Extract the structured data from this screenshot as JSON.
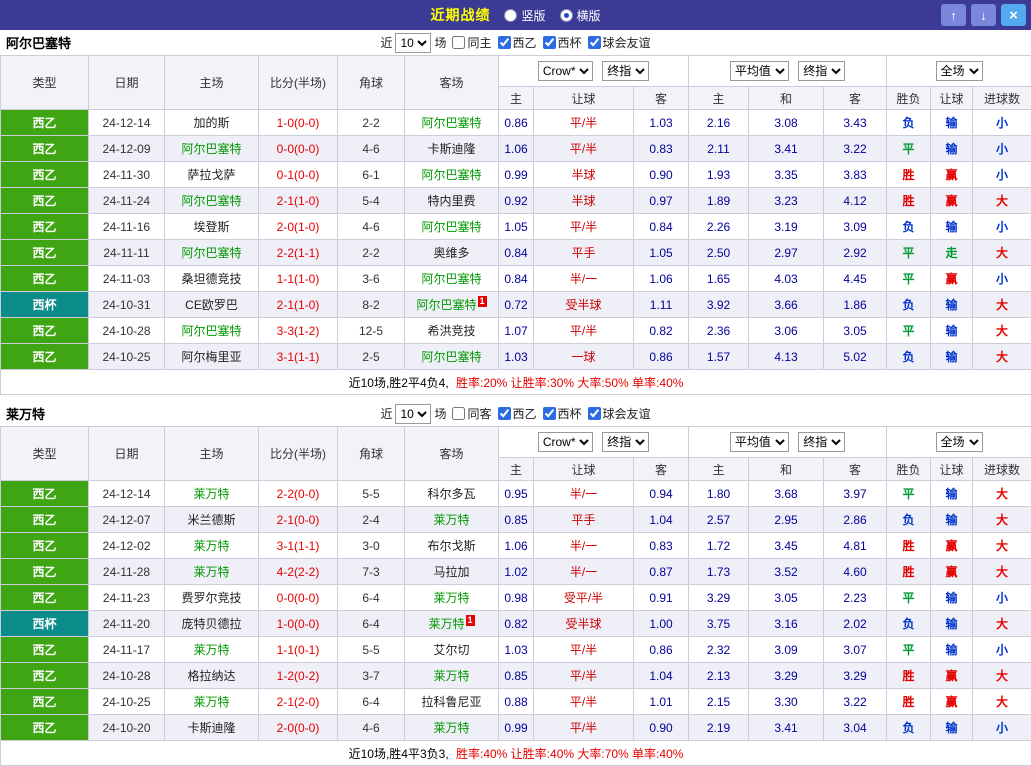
{
  "topbar": {
    "title": "近期战绩",
    "radios": [
      {
        "label": "竖版",
        "selected": false
      },
      {
        "label": "横版",
        "selected": true
      }
    ],
    "up_button": "↑",
    "down_button": "↓",
    "close_button": "×"
  },
  "palette": {
    "red": "#e60000",
    "green": "#009933",
    "blue": "#0033cc"
  },
  "value_colors": {
    "胜": "red",
    "平": "green",
    "负": "blue",
    "赢": "red",
    "走": "green",
    "输": "blue",
    "大": "red",
    "小": "blue"
  },
  "league_colors": {
    "西乙": "#3fa513",
    "西杯": "#0c8b8b"
  },
  "sections": [
    {
      "team": "阿尔巴塞特",
      "filter": {
        "near": "近",
        "count": "10",
        "unit": "场",
        "checkboxes": [
          {
            "label": "同主",
            "checked": false
          },
          {
            "label": "西乙",
            "checked": true
          },
          {
            "label": "西杯",
            "checked": true
          },
          {
            "label": "球会友谊",
            "checked": true
          }
        ]
      },
      "header": {
        "type": "类型",
        "date": "日期",
        "home": "主场",
        "score": "比分(半场)",
        "corner": "角球",
        "away": "客场",
        "odds_select_1": "Crow*",
        "odds_select_2": "终指",
        "avg_select_1": "平均值",
        "avg_select_2": "终指",
        "scope_select": "全场",
        "sub_home": "主",
        "sub_handicap": "让球",
        "sub_away": "客",
        "sub_avg_home": "主",
        "sub_draw": "和",
        "sub_avg_away": "客",
        "sub_result": "胜负",
        "sub_handicap2": "让球",
        "sub_goals": "进球数"
      },
      "rows": [
        {
          "league": "西乙",
          "date": "24-12-14",
          "home": "加的斯",
          "score": "1-0(0-0)",
          "corner": "2-2",
          "away": "阿尔巴塞特",
          "odds": [
            "0.86",
            "平/半",
            "1.03"
          ],
          "avg": [
            "2.16",
            "3.08",
            "3.43"
          ],
          "result": "负",
          "handicap": "输",
          "goals": "小"
        },
        {
          "league": "西乙",
          "date": "24-12-09",
          "home": "阿尔巴塞特",
          "score": "0-0(0-0)",
          "corner": "4-6",
          "away": "卡斯迪隆",
          "odds": [
            "1.06",
            "平/半",
            "0.83"
          ],
          "avg": [
            "2.11",
            "3.41",
            "3.22"
          ],
          "result": "平",
          "handicap": "输",
          "goals": "小"
        },
        {
          "league": "西乙",
          "date": "24-11-30",
          "home": "萨拉戈萨",
          "score": "0-1(0-0)",
          "corner": "6-1",
          "away": "阿尔巴塞特",
          "odds": [
            "0.99",
            "半球",
            "0.90"
          ],
          "avg": [
            "1.93",
            "3.35",
            "3.83"
          ],
          "result": "胜",
          "handicap": "赢",
          "goals": "小"
        },
        {
          "league": "西乙",
          "date": "24-11-24",
          "home": "阿尔巴塞特",
          "score": "2-1(1-0)",
          "corner": "5-4",
          "away": "特内里费",
          "odds": [
            "0.92",
            "半球",
            "0.97"
          ],
          "avg": [
            "1.89",
            "3.23",
            "4.12"
          ],
          "result": "胜",
          "handicap": "赢",
          "goals": "大"
        },
        {
          "league": "西乙",
          "date": "24-11-16",
          "home": "埃登斯",
          "score": "2-0(1-0)",
          "corner": "4-6",
          "away": "阿尔巴塞特",
          "odds": [
            "1.05",
            "平/半",
            "0.84"
          ],
          "avg": [
            "2.26",
            "3.19",
            "3.09"
          ],
          "result": "负",
          "handicap": "输",
          "goals": "小"
        },
        {
          "league": "西乙",
          "date": "24-11-11",
          "home": "阿尔巴塞特",
          "score": "2-2(1-1)",
          "corner": "2-2",
          "away": "奥维多",
          "odds": [
            "0.84",
            "平手",
            "1.05"
          ],
          "avg": [
            "2.50",
            "2.97",
            "2.92"
          ],
          "result": "平",
          "handicap": "走",
          "goals": "大"
        },
        {
          "league": "西乙",
          "date": "24-11-03",
          "home": "桑坦德竞技",
          "score": "1-1(1-0)",
          "corner": "3-6",
          "away": "阿尔巴塞特",
          "odds": [
            "0.84",
            "半/一",
            "1.06"
          ],
          "avg": [
            "1.65",
            "4.03",
            "4.45"
          ],
          "result": "平",
          "handicap": "赢",
          "goals": "小"
        },
        {
          "league": "西杯",
          "date": "24-10-31",
          "home": "CE欧罗巴",
          "score": "2-1(1-0)",
          "corner": "8-2",
          "away": "阿尔巴塞特",
          "away_badge": "1",
          "odds": [
            "0.72",
            "受半球",
            "1.11"
          ],
          "avg": [
            "3.92",
            "3.66",
            "1.86"
          ],
          "result": "负",
          "handicap": "输",
          "goals": "大"
        },
        {
          "league": "西乙",
          "date": "24-10-28",
          "home": "阿尔巴塞特",
          "score": "3-3(1-2)",
          "corner": "12-5",
          "away": "希洪竞技",
          "odds": [
            "1.07",
            "平/半",
            "0.82"
          ],
          "avg": [
            "2.36",
            "3.06",
            "3.05"
          ],
          "result": "平",
          "handicap": "输",
          "goals": "大"
        },
        {
          "league": "西乙",
          "date": "24-10-25",
          "home": "阿尔梅里亚",
          "score": "3-1(1-1)",
          "corner": "2-5",
          "away": "阿尔巴塞特",
          "odds": [
            "1.03",
            "一球",
            "0.86"
          ],
          "avg": [
            "1.57",
            "4.13",
            "5.02"
          ],
          "result": "负",
          "handicap": "输",
          "goals": "大"
        }
      ],
      "summary": {
        "prefix": "近10场,胜2平4负4,",
        "stats": "胜率:20% 让胜率:30% 大率:50% 单率:40%"
      }
    },
    {
      "team": "莱万特",
      "filter": {
        "near": "近",
        "count": "10",
        "unit": "场",
        "checkboxes": [
          {
            "label": "同客",
            "checked": false
          },
          {
            "label": "西乙",
            "checked": true
          },
          {
            "label": "西杯",
            "checked": true
          },
          {
            "label": "球会友谊",
            "checked": true
          }
        ]
      },
      "header": {
        "type": "类型",
        "date": "日期",
        "home": "主场",
        "score": "比分(半场)",
        "corner": "角球",
        "away": "客场",
        "odds_select_1": "Crow*",
        "odds_select_2": "终指",
        "avg_select_1": "平均值",
        "avg_select_2": "终指",
        "scope_select": "全场",
        "sub_home": "主",
        "sub_handicap": "让球",
        "sub_away": "客",
        "sub_avg_home": "主",
        "sub_draw": "和",
        "sub_avg_away": "客",
        "sub_result": "胜负",
        "sub_handicap2": "让球",
        "sub_goals": "进球数"
      },
      "rows": [
        {
          "league": "西乙",
          "date": "24-12-14",
          "home": "莱万特",
          "score": "2-2(0-0)",
          "corner": "5-5",
          "away": "科尔多瓦",
          "odds": [
            "0.95",
            "半/一",
            "0.94"
          ],
          "avg": [
            "1.80",
            "3.68",
            "3.97"
          ],
          "result": "平",
          "handicap": "输",
          "goals": "大"
        },
        {
          "league": "西乙",
          "date": "24-12-07",
          "home": "米兰德斯",
          "score": "2-1(0-0)",
          "corner": "2-4",
          "away": "莱万特",
          "odds": [
            "0.85",
            "平手",
            "1.04"
          ],
          "avg": [
            "2.57",
            "2.95",
            "2.86"
          ],
          "result": "负",
          "handicap": "输",
          "goals": "大"
        },
        {
          "league": "西乙",
          "date": "24-12-02",
          "home": "莱万特",
          "score": "3-1(1-1)",
          "corner": "3-0",
          "away": "布尔戈斯",
          "odds": [
            "1.06",
            "半/一",
            "0.83"
          ],
          "avg": [
            "1.72",
            "3.45",
            "4.81"
          ],
          "result": "胜",
          "handicap": "赢",
          "goals": "大"
        },
        {
          "league": "西乙",
          "date": "24-11-28",
          "home": "莱万特",
          "score": "4-2(2-2)",
          "corner": "7-3",
          "away": "马拉加",
          "odds": [
            "1.02",
            "半/一",
            "0.87"
          ],
          "avg": [
            "1.73",
            "3.52",
            "4.60"
          ],
          "result": "胜",
          "handicap": "赢",
          "goals": "大"
        },
        {
          "league": "西乙",
          "date": "24-11-23",
          "home": "费罗尔竞技",
          "score": "0-0(0-0)",
          "corner": "6-4",
          "away": "莱万特",
          "odds": [
            "0.98",
            "受平/半",
            "0.91"
          ],
          "avg": [
            "3.29",
            "3.05",
            "2.23"
          ],
          "result": "平",
          "handicap": "输",
          "goals": "小"
        },
        {
          "league": "西杯",
          "date": "24-11-20",
          "home": "庞特贝德拉",
          "score": "1-0(0-0)",
          "corner": "6-4",
          "away": "莱万特",
          "away_badge": "1",
          "odds": [
            "0.82",
            "受半球",
            "1.00"
          ],
          "avg": [
            "3.75",
            "3.16",
            "2.02"
          ],
          "result": "负",
          "handicap": "输",
          "goals": "大"
        },
        {
          "league": "西乙",
          "date": "24-11-17",
          "home": "莱万特",
          "score": "1-1(0-1)",
          "corner": "5-5",
          "away": "艾尔切",
          "odds": [
            "1.03",
            "平/半",
            "0.86"
          ],
          "avg": [
            "2.32",
            "3.09",
            "3.07"
          ],
          "result": "平",
          "handicap": "输",
          "goals": "小"
        },
        {
          "league": "西乙",
          "date": "24-10-28",
          "home": "格拉纳达",
          "score": "1-2(0-2)",
          "corner": "3-7",
          "away": "莱万特",
          "odds": [
            "0.85",
            "平/半",
            "1.04"
          ],
          "avg": [
            "2.13",
            "3.29",
            "3.29"
          ],
          "result": "胜",
          "handicap": "赢",
          "goals": "大"
        },
        {
          "league": "西乙",
          "date": "24-10-25",
          "home": "莱万特",
          "score": "2-1(2-0)",
          "corner": "6-4",
          "away": "拉科鲁尼亚",
          "odds": [
            "0.88",
            "平/半",
            "1.01"
          ],
          "avg": [
            "2.15",
            "3.30",
            "3.22"
          ],
          "result": "胜",
          "handicap": "赢",
          "goals": "大"
        },
        {
          "league": "西乙",
          "date": "24-10-20",
          "home": "卡斯迪隆",
          "score": "2-0(0-0)",
          "corner": "4-6",
          "away": "莱万特",
          "odds": [
            "0.99",
            "平/半",
            "0.90"
          ],
          "avg": [
            "2.19",
            "3.41",
            "3.04"
          ],
          "result": "负",
          "handicap": "输",
          "goals": "小"
        }
      ],
      "summary": {
        "prefix": "近10场,胜4平3负3,",
        "stats": "胜率:40% 让胜率:40% 大率:70% 单率:40%"
      }
    }
  ]
}
